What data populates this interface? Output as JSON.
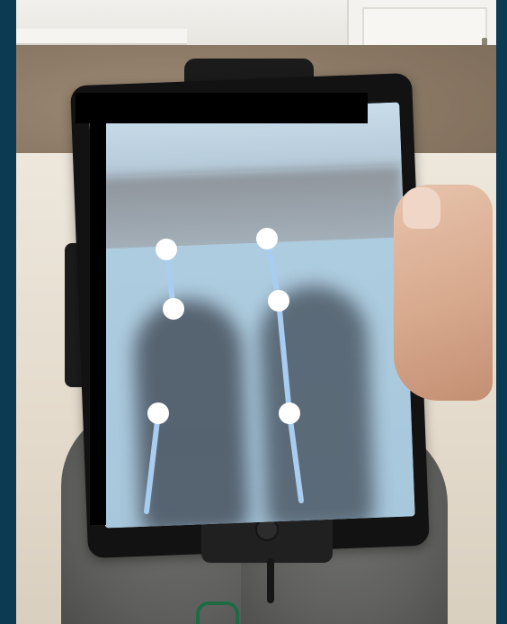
{
  "scene": {
    "subject": "tablet-mounted-pose-overlay",
    "colors": {
      "border": "#0c3a52",
      "skeleton_line": "#a9cdf0",
      "keypoint": "#ffffff",
      "screen_tint": "#bcd4e4"
    },
    "keypoints": [
      {
        "name": "left-hip"
      },
      {
        "name": "left-knee"
      },
      {
        "name": "left-ankle"
      },
      {
        "name": "right-hip"
      },
      {
        "name": "right-knee"
      },
      {
        "name": "right-ankle"
      }
    ]
  }
}
